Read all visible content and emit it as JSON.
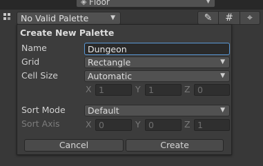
{
  "top_toolbar": {
    "layer_dropdown": {
      "icon": "layers-icon",
      "value": "Floor"
    }
  },
  "palette_bar": {
    "palette_icon": "palette-icon",
    "palette_dropdown": {
      "value": "No Valid Palette"
    },
    "tools": [
      {
        "icon": "pencil-icon",
        "glyph": "✎"
      },
      {
        "icon": "grid-icon",
        "glyph": "#"
      },
      {
        "icon": "crosshair-icon",
        "glyph": "⌖"
      }
    ]
  },
  "create_palette": {
    "title": "Create New Palette",
    "name": {
      "label": "Name",
      "value": "Dungeon"
    },
    "grid": {
      "label": "Grid",
      "value": "Rectangle"
    },
    "cell_size": {
      "label": "Cell Size",
      "value": "Automatic",
      "x": {
        "label": "X",
        "value": "1"
      },
      "y": {
        "label": "Y",
        "value": "1"
      },
      "z": {
        "label": "Z",
        "value": "0"
      }
    },
    "sort_mode": {
      "label": "Sort Mode",
      "value": "Default"
    },
    "sort_axis": {
      "label": "Sort Axis",
      "x": {
        "label": "X",
        "value": "0"
      },
      "y": {
        "label": "Y",
        "value": "0"
      },
      "z": {
        "label": "Z",
        "value": "1"
      }
    },
    "buttons": {
      "cancel": "Cancel",
      "create": "Create"
    }
  },
  "colors": {
    "background": "#383838",
    "panel": "#3c3c3c",
    "focus_border": "#5b9ad8"
  }
}
